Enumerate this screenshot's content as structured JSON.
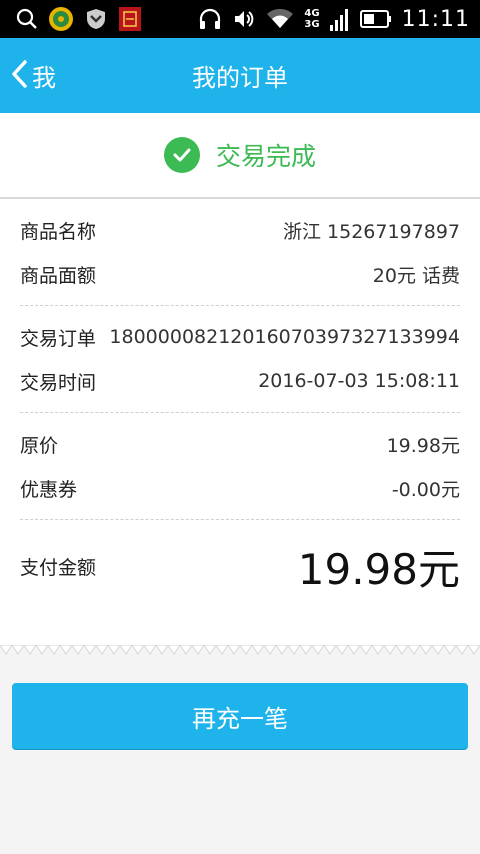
{
  "status_bar": {
    "time": "11:11",
    "network_4g": "4G",
    "network_3g": "3G",
    "icons": [
      "search-icon",
      "music-app-icon",
      "shield-app-icon",
      "red-app-icon",
      "headphones-icon",
      "volume-icon",
      "wifi-icon",
      "signal-icon",
      "battery-icon"
    ]
  },
  "header": {
    "back_label": "我",
    "title": "我的订单",
    "color": "#1fb3ec"
  },
  "status": {
    "text": "交易完成",
    "color": "#3cba54"
  },
  "goods": [
    {
      "label": "商品名称",
      "value": "浙江 15267197897"
    },
    {
      "label": "商品面额",
      "value": "20元 话费"
    }
  ],
  "trade": [
    {
      "label": "交易订单",
      "value": "18000008212016070397327133994"
    },
    {
      "label": "交易时间",
      "value": "2016-07-03 15:08:11"
    }
  ],
  "price": [
    {
      "label": "原价",
      "value": "19.98元"
    },
    {
      "label": "优惠券",
      "value": "-0.00元"
    }
  ],
  "payment": {
    "label": "支付金额",
    "amount": "19.98元"
  },
  "action": {
    "recharge_label": "再充一笔"
  }
}
